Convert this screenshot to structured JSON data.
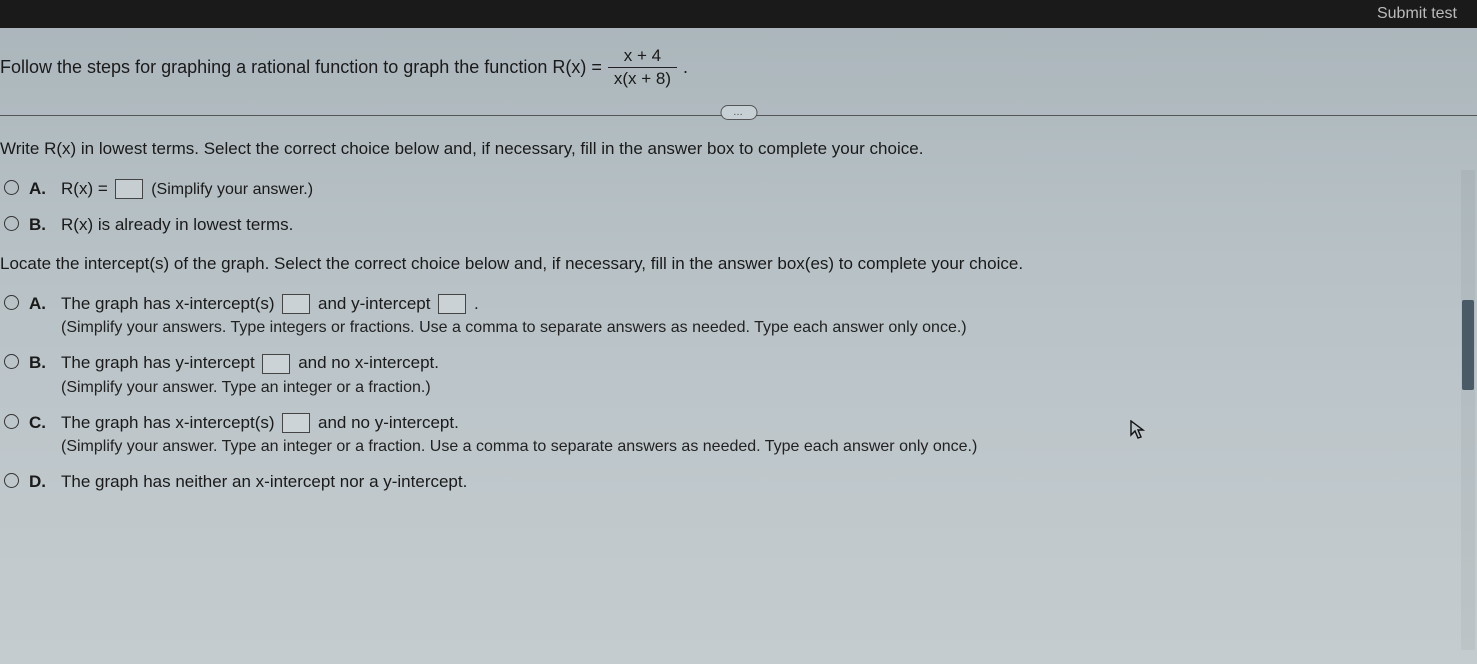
{
  "topbar": {
    "submit": "Submit test"
  },
  "prompt": {
    "lead": "Follow the steps for graphing a rational function to graph the function R(x) =",
    "numerator": "x + 4",
    "denominator": "x(x + 8)",
    "trail": "."
  },
  "pill": "…",
  "q1": {
    "prompt": "Write R(x) in lowest terms. Select the correct choice below and, if necessary, fill in the answer box to complete your choice.",
    "A": {
      "label": "A.",
      "pre": "R(x) =",
      "hint": "(Simplify your answer.)"
    },
    "B": {
      "label": "B.",
      "text": "R(x) is already in lowest terms."
    }
  },
  "q2": {
    "prompt": "Locate the intercept(s) of the graph. Select the correct choice below and, if necessary, fill in the answer box(es) to complete your choice.",
    "A": {
      "label": "A.",
      "t1": "The graph has x-intercept(s)",
      "t2": "and y-intercept",
      "t3": ".",
      "hint": "(Simplify your answers. Type integers or fractions. Use a comma to separate answers as needed. Type each answer only once.)"
    },
    "B": {
      "label": "B.",
      "t1": "The graph has y-intercept",
      "t2": "and no x-intercept.",
      "hint": "(Simplify your answer. Type an integer or a fraction.)"
    },
    "C": {
      "label": "C.",
      "t1": "The graph has x-intercept(s)",
      "t2": "and no y-intercept.",
      "hint": "(Simplify your answer. Type an integer or a fraction. Use a comma to separate answers as needed. Type each answer only once.)"
    },
    "D": {
      "label": "D.",
      "text": "The graph has neither an x-intercept nor a y-intercept."
    }
  }
}
